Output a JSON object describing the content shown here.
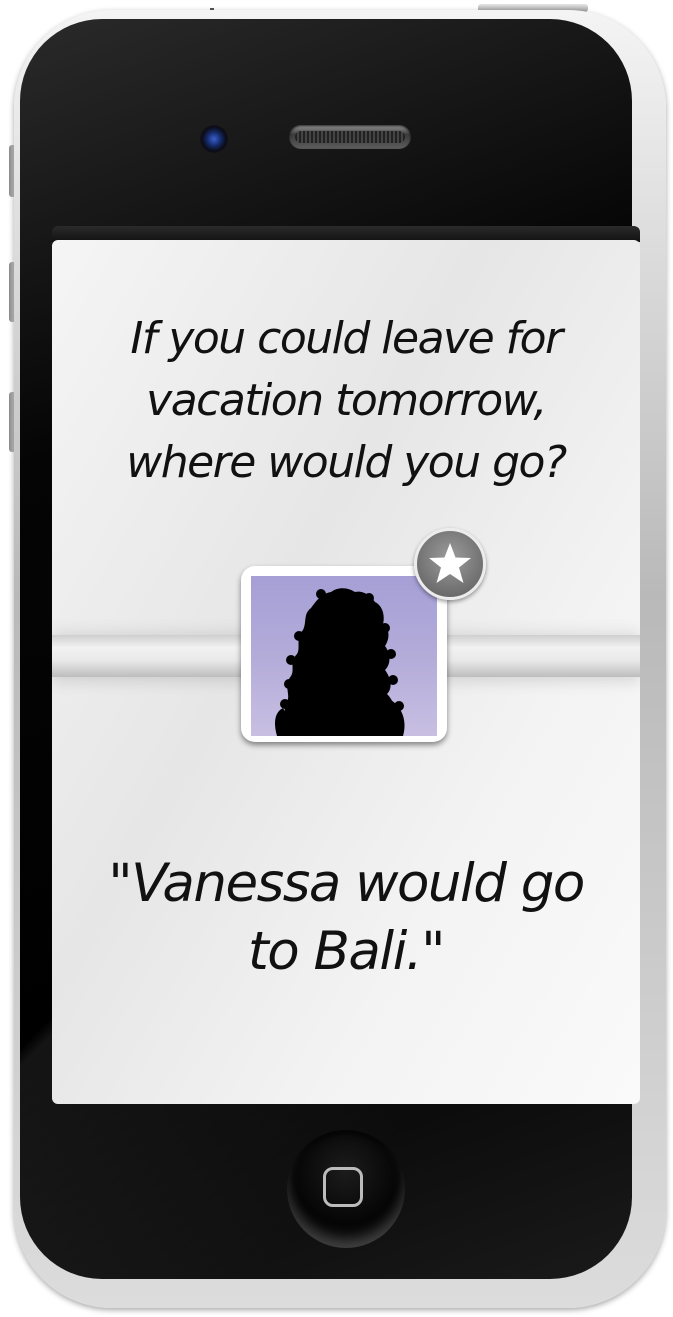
{
  "card": {
    "question": "If you could leave for vacation tomorrow, where would you go?",
    "answer": "\"Vanessa would go to Bali.\""
  },
  "avatar": {
    "icon": "person-silhouette-icon",
    "background_color": "#b0a9d9"
  },
  "badge": {
    "icon": "star-icon"
  },
  "device": {
    "model": "phone-frame",
    "home_icon": "home-square-icon"
  }
}
